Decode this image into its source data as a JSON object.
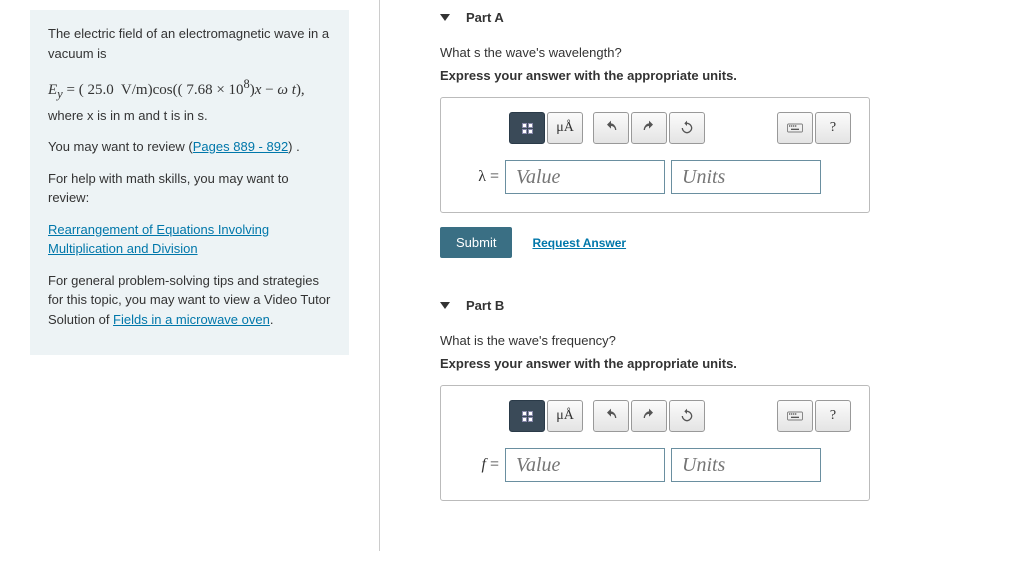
{
  "sidebar": {
    "intro1": "The electric field of an electromagnetic wave in a vacuum is",
    "intro2": "where x is in m and t is in s.",
    "review_prefix": "You may want to review (",
    "pages_link": "Pages 889 - 892",
    "review_suffix": ") .",
    "math_help": "For help with math skills, you may want to review:",
    "rearr_link": "Rearrangement of Equations Involving Multiplication and Division",
    "tutor_prefix": "For general problem-solving tips and strategies for this topic, you may want to view a Video Tutor Solution of ",
    "tutor_link": "Fields in a microwave oven",
    "period": "."
  },
  "toolbar": {
    "units_label": "μÅ",
    "help": "?"
  },
  "parts": {
    "a": {
      "title": "Part A",
      "question": "What s the wave's wavelength?",
      "instruction": "Express your answer with the appropriate units.",
      "var": "λ =",
      "value_ph": "Value",
      "units_ph": "Units",
      "submit": "Submit",
      "request": "Request Answer"
    },
    "b": {
      "title": "Part B",
      "question": "What is the wave's frequency?",
      "instruction": "Express your answer with the appropriate units.",
      "var": "f =",
      "value_ph": "Value",
      "units_ph": "Units"
    }
  }
}
